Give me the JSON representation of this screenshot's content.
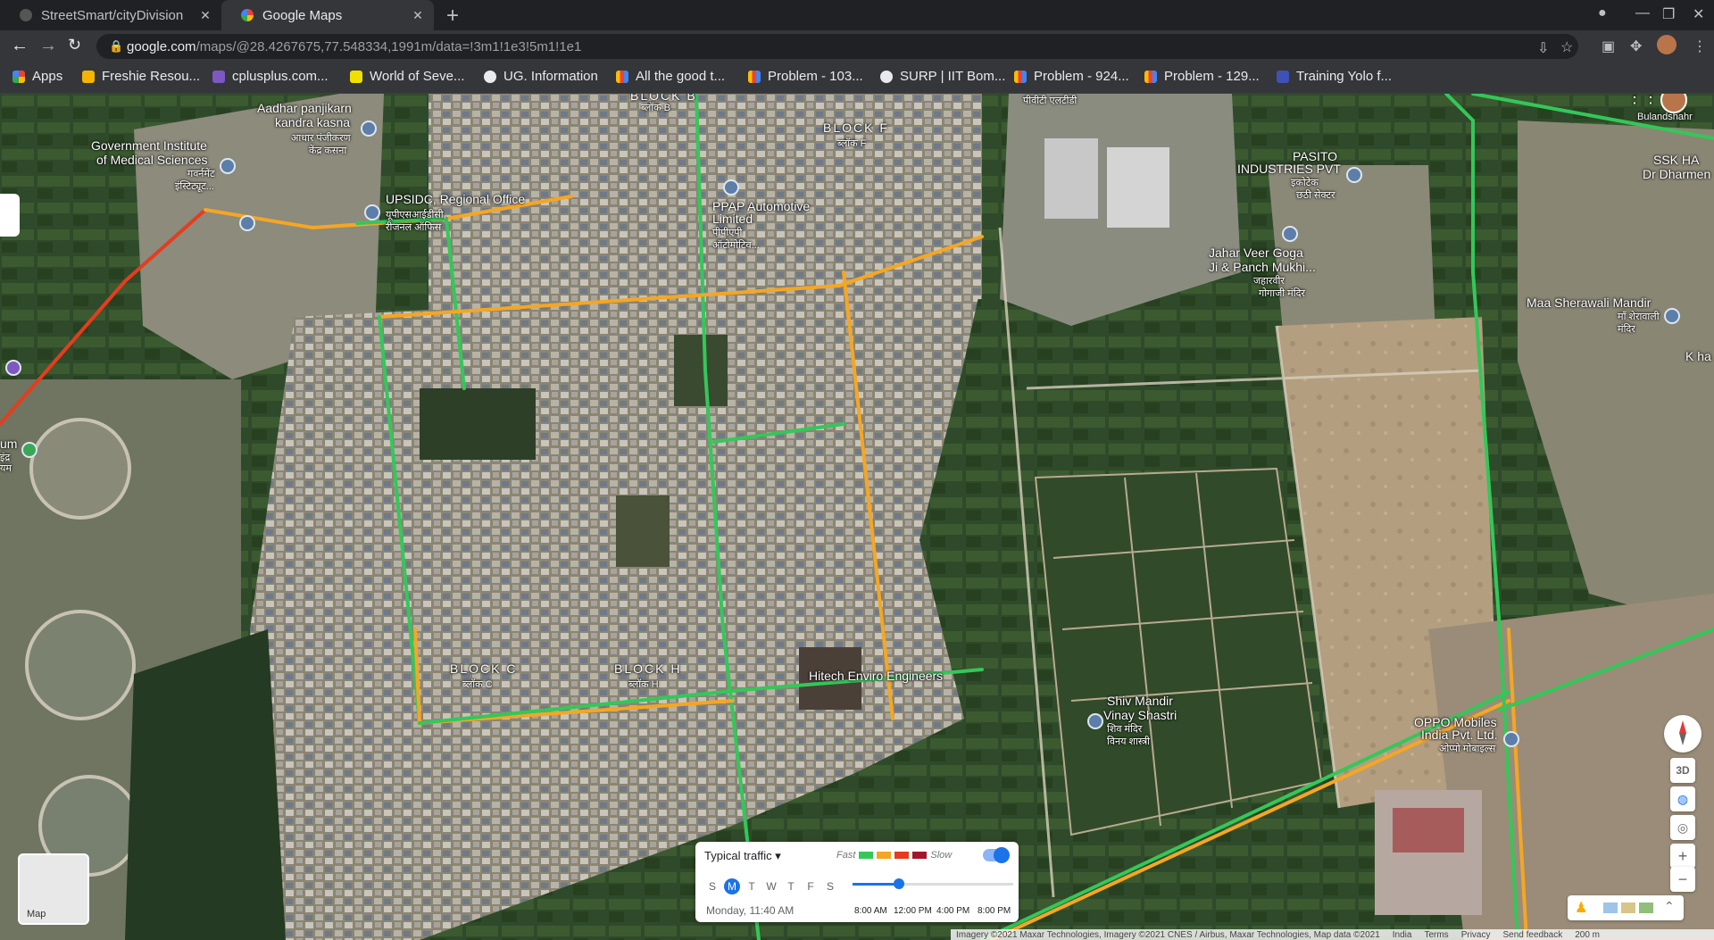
{
  "tabs": [
    {
      "title": "StreetSmart/cityDivision",
      "active": false
    },
    {
      "title": "Google Maps",
      "active": true
    }
  ],
  "url": {
    "host": "google.com",
    "path": "/maps/@28.4267675,77.548334,1991m/data=!3m1!1e3!5m1!1e1"
  },
  "bookmarks": [
    "Apps",
    "Freshie Resou...",
    "cplusplus.com...",
    "World of Seve...",
    "UG. Information",
    "All the good t...",
    "Problem - 103...",
    "SURP | IIT Bom...",
    "Problem - 924...",
    "Problem - 129...",
    "Training Yolo f..."
  ],
  "map": {
    "labels": [
      {
        "text": "Aadhar panjikarn",
        "sub": "kandra kasna"
      },
      {
        "text": "आधार पंजीकरण"
      },
      {
        "text": "केंद्र कसना"
      },
      {
        "text": "Government Institute"
      },
      {
        "text": "of Medical Sciences"
      },
      {
        "text": "गवर्नमेंट"
      },
      {
        "text": "इंस्टिट्यूट..."
      },
      {
        "text": "UPSIDC, Regional Office"
      },
      {
        "text": "यूपीएसआईडीसी,"
      },
      {
        "text": "रीजनल ऑफिस"
      },
      {
        "text": "PPAP Automotive"
      },
      {
        "text": "Limited"
      },
      {
        "text": "पीपीएपी"
      },
      {
        "text": "ऑटोमोटिव..."
      },
      {
        "text": "BLOCK F"
      },
      {
        "text": "ब्लॉक F"
      },
      {
        "text": "BLOCK B"
      },
      {
        "text": "ब्लॉक B"
      },
      {
        "text": "पीवीटी एलटीडी"
      },
      {
        "text": "PASITO"
      },
      {
        "text": "INDUSTRIES PVT"
      },
      {
        "text": "इकोटेक"
      },
      {
        "text": "छठी सेक्टर"
      },
      {
        "text": "Jahar Veer Goga"
      },
      {
        "text": "Ji & Panch Mukhi..."
      },
      {
        "text": "जहारवीर"
      },
      {
        "text": "गोगाजी मंदिर"
      },
      {
        "text": "Maa Sherawali Mandir"
      },
      {
        "text": "माँ शेरावाली"
      },
      {
        "text": "मंदिर"
      },
      {
        "text": "SSK HA"
      },
      {
        "text": "Dr Dharmen"
      },
      {
        "text": "Bulandshahr"
      },
      {
        "text": "K ha"
      },
      {
        "text": "BLOCK C"
      },
      {
        "text": "ब्लॉक C"
      },
      {
        "text": "BLOCK H"
      },
      {
        "text": "ब्लॉक H"
      },
      {
        "text": "Hitech Enviro Engineers"
      },
      {
        "text": "Shiv Mandir"
      },
      {
        "text": "Vinay Shastri"
      },
      {
        "text": "शिव मंदिर"
      },
      {
        "text": "विनय शास्त्री"
      },
      {
        "text": "OPPO Mobiles"
      },
      {
        "text": "India Pvt. Ltd."
      },
      {
        "text": "ओप्पो मोबाइल्स"
      },
      {
        "text": "um"
      },
      {
        "text": "इंद्र"
      },
      {
        "text": "यम"
      }
    ]
  },
  "traffic": {
    "mode": "Typical traffic",
    "legend_fast": "Fast",
    "legend_slow": "Slow",
    "legend_colors": [
      "#34c759",
      "#f5a623",
      "#e63c1e",
      "#a5162a"
    ],
    "days": [
      "S",
      "M",
      "T",
      "W",
      "T",
      "F",
      "S"
    ],
    "selected_day": 1,
    "datetime": "Monday, 11:40 AM",
    "ticks": [
      "8:00 AM",
      "12:00 PM",
      "4:00 PM",
      "8:00 PM"
    ],
    "slider_position": 0.29,
    "enabled": true
  },
  "controls": {
    "three_d": "3D",
    "zoom_in": "+",
    "zoom_out": "−",
    "minimap_label": "Map"
  },
  "footer": {
    "imagery": "Imagery ©2021 Maxar Technologies, Imagery ©2021 CNES / Airbus, Maxar Technologies, Map data ©2021",
    "region": "India",
    "terms": "Terms",
    "privacy": "Privacy",
    "feedback": "Send feedback",
    "scale": "200 m"
  }
}
